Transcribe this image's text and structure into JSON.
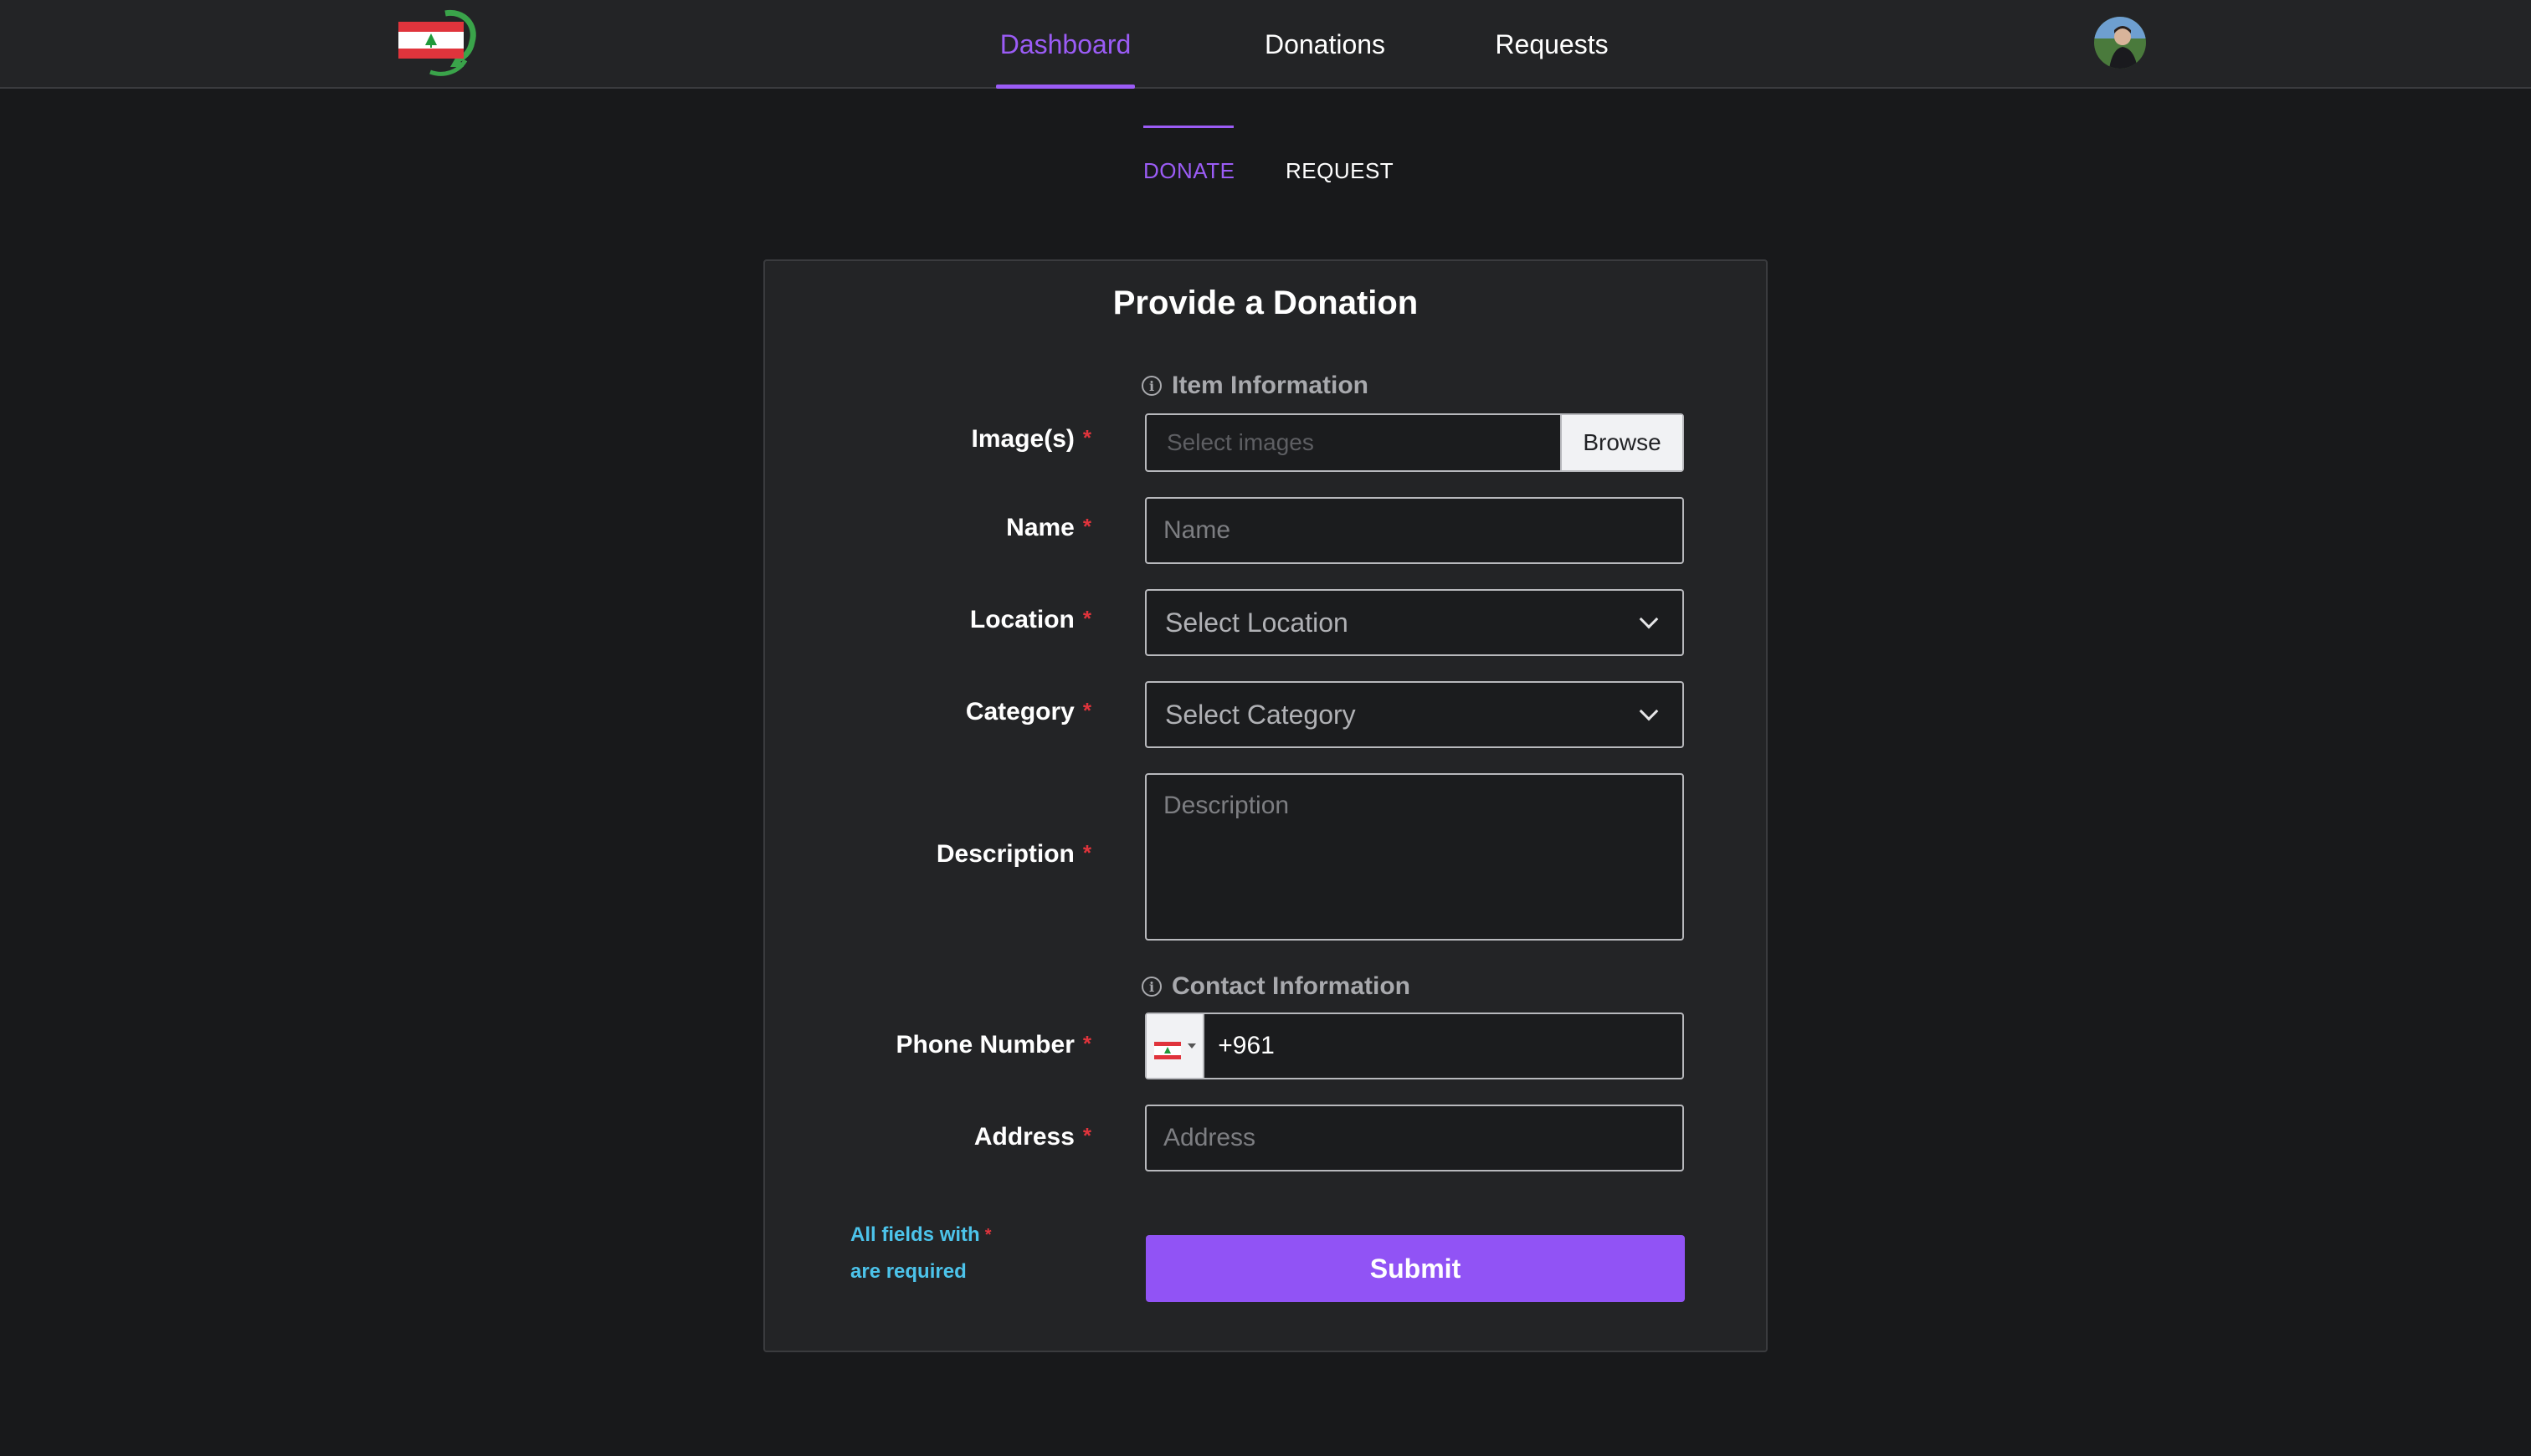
{
  "nav": {
    "items": [
      {
        "label": "Dashboard",
        "active": true
      },
      {
        "label": "Donations",
        "active": false
      },
      {
        "label": "Requests",
        "active": false
      }
    ],
    "accent": "#9b5cf6"
  },
  "tabs": [
    {
      "label": "DONATE",
      "active": true
    },
    {
      "label": "REQUEST",
      "active": false
    }
  ],
  "form": {
    "title": "Provide a Donation",
    "sections": {
      "item": "Item Information",
      "contact": "Contact Information"
    },
    "fields": {
      "images": {
        "label": "Image(s)",
        "placeholder": "Select images",
        "button": "Browse"
      },
      "name": {
        "label": "Name",
        "placeholder": "Name"
      },
      "location": {
        "label": "Location",
        "placeholder": "Select Location"
      },
      "category": {
        "label": "Category",
        "placeholder": "Select Category"
      },
      "description": {
        "label": "Description",
        "placeholder": "Description"
      },
      "phone": {
        "label": "Phone Number",
        "value": "+961"
      },
      "address": {
        "label": "Address",
        "placeholder": "Address"
      }
    },
    "required_star": "*",
    "required_note": {
      "line1": "All fields with",
      "line2": "are required"
    },
    "submit_label": "Submit"
  },
  "icons": {
    "logo": "lebanon-flag-recycle-logo",
    "info": "info-circle-icon",
    "chevron": "chevron-down-icon",
    "flag": "lebanon-flag-icon",
    "avatar": "user-avatar"
  }
}
